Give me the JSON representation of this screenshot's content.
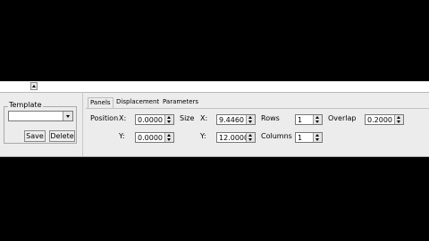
{
  "template": {
    "legend": "Template",
    "selected": "",
    "save_label": "Save",
    "delete_label": "Delete"
  },
  "tabs": [
    {
      "label": "Panels"
    },
    {
      "label": "Displacement"
    },
    {
      "label": "Parameters"
    }
  ],
  "panels": {
    "position_label": "Position",
    "size_label": "Size",
    "x_label": "X:",
    "y_label": "Y:",
    "position_x": "0.0000",
    "position_y": "0.0000",
    "size_x": "9.4460",
    "size_y": "12.0000",
    "rows_label": "Rows",
    "rows": "1",
    "columns_label": "Columns",
    "columns": "1",
    "overlap_label": "Overlap",
    "overlap": "0.2000"
  },
  "icons": [
    "scroll-up-icon",
    "dropdown-arrow-icon",
    "spin-up-icon",
    "spin-down-icon"
  ]
}
